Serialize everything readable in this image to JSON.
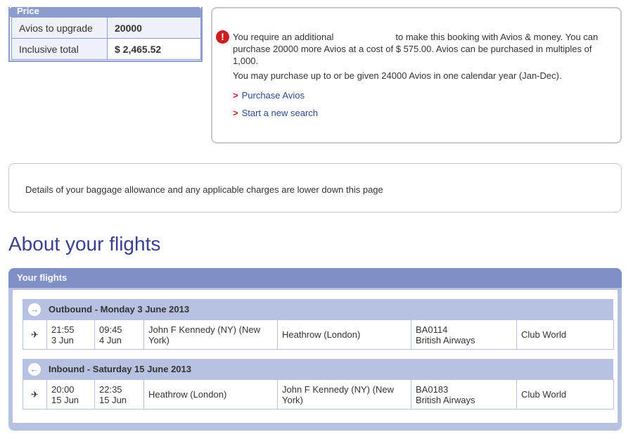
{
  "price": {
    "header": "Price",
    "rows": [
      {
        "label": "Avios to upgrade",
        "value": "20000"
      },
      {
        "label": "Inclusive total",
        "value": "$ 2,465.52"
      }
    ]
  },
  "notice": {
    "line1_a": "You require an additional",
    "line1_b": "to make this booking with Avios & money.",
    "line2": "You can purchase 20000 more Avios at a cost of $ 575.00. Avios can be purchased in multiples of 1,000.",
    "line3": "You may purchase up to or be given 24000 Avios in one calendar year (Jan-Dec).",
    "link_purchase": "Purchase Avios",
    "link_search": "Start a new search",
    "link_arrow": ">"
  },
  "baggage": {
    "text": "Details of your baggage allowance and any applicable charges are lower down this page"
  },
  "page_title": "About your flights",
  "flights": {
    "header": "Your flights",
    "segments": [
      {
        "title": "Outbound - Monday 3 June 2013",
        "dep_time": "21:55",
        "dep_date": "3 Jun",
        "arr_time": "09:45",
        "arr_date": "4 Jun",
        "from": "John F Kennedy (NY) (New York)",
        "to": "Heathrow (London)",
        "flight_no": "BA0114",
        "airline": "British Airways",
        "cabin": "Club World"
      },
      {
        "title": "Inbound - Saturday 15 June 2013",
        "dep_time": "20:00",
        "dep_date": "15 Jun",
        "arr_time": "22:35",
        "arr_date": "15 Jun",
        "from": "Heathrow (London)",
        "to": "John F Kennedy (NY) (New York)",
        "flight_no": "BA0183",
        "airline": "British Airways",
        "cabin": "Club World"
      }
    ]
  },
  "icons": {
    "warning": "warning-icon",
    "outbound": "arrow-right-circle-icon",
    "inbound": "arrow-left-circle-icon",
    "plane": "airplane-icon"
  },
  "colors": {
    "accent": "#8b9ccd",
    "header": "#7f90c6",
    "title": "#3a3f8e",
    "link": "#2a4b8d",
    "alert": "#cc1f1f"
  }
}
